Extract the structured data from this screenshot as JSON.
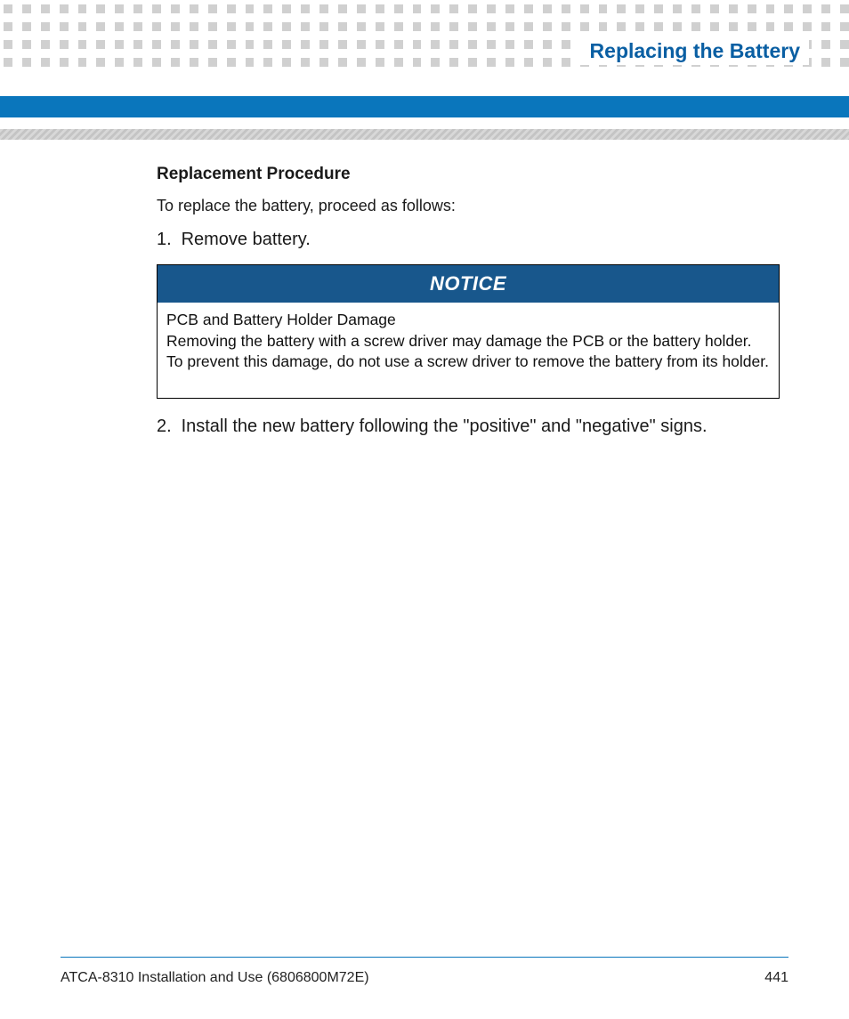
{
  "header": {
    "chapter_title": "Replacing the Battery"
  },
  "content": {
    "section_heading": "Replacement Procedure",
    "intro": "To replace the battery, proceed as follows:",
    "steps": {
      "step1_num": "1.",
      "step1_text": "Remove battery.",
      "step2_num": "2.",
      "step2_text": "Install the new battery following the \"positive\" and \"negative\" signs."
    },
    "notice": {
      "label": "NOTICE",
      "title": "PCB and Battery Holder Damage",
      "body": "Removing the battery with a screw driver may damage the PCB or the battery holder. To prevent this damage, do not use a screw driver to remove the battery from its holder."
    }
  },
  "footer": {
    "doc_title": "ATCA-8310 Installation and Use (6806800M72E)",
    "page_number": "441"
  }
}
